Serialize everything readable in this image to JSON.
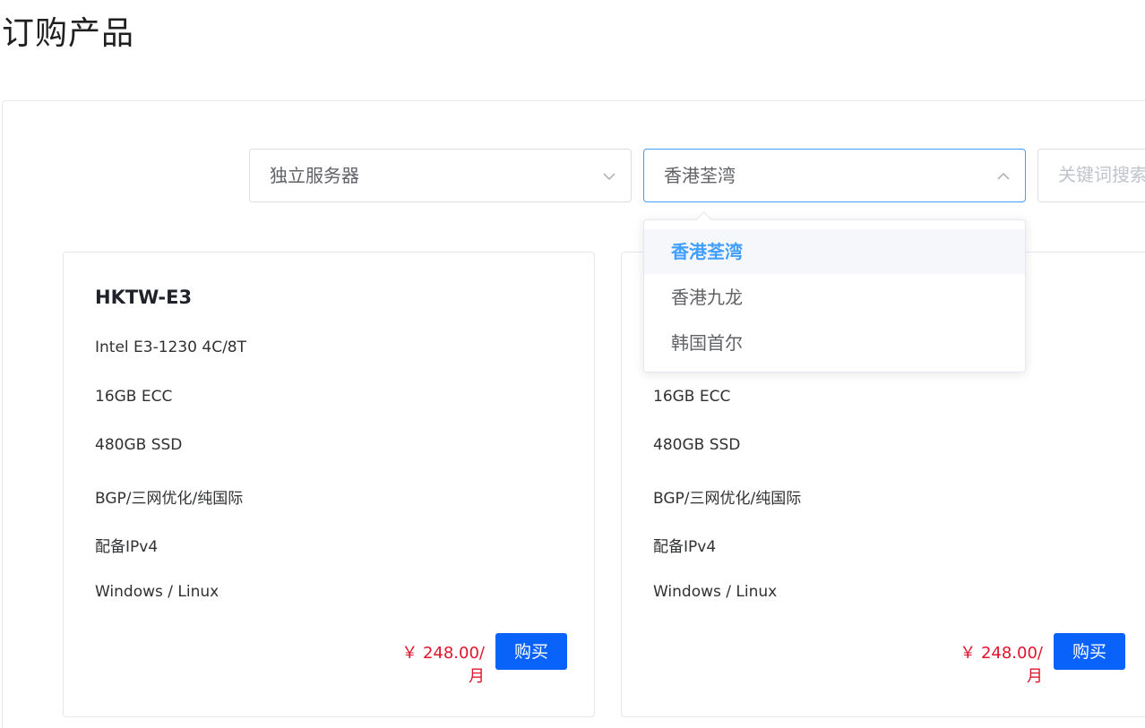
{
  "page_title": "订购产品",
  "filters": {
    "type_select": {
      "value": "独立服务器"
    },
    "region_select": {
      "value": "香港荃湾",
      "options": [
        "香港荃湾",
        "香港九龙",
        "韩国首尔"
      ]
    },
    "search": {
      "placeholder": "关键词搜索"
    }
  },
  "products": [
    {
      "name": "HKTW-E3",
      "specs": [
        "Intel E3-1230 4C/8T",
        "16GB ECC",
        "480GB SSD",
        "BGP/三网优化/纯国际",
        "配备IPv4",
        "Windows / Linux"
      ],
      "price": "￥ 248.00/月",
      "buy_label": "购买"
    },
    {
      "name": "",
      "specs": [
        "",
        "16GB ECC",
        "480GB SSD",
        "BGP/三网优化/纯国际",
        "配备IPv4",
        "Windows / Linux"
      ],
      "price": "￥ 248.00/月",
      "buy_label": "购买"
    }
  ],
  "colors": {
    "accent": "#409eff",
    "buy_button": "#0962fa",
    "price": "#e0142c"
  }
}
